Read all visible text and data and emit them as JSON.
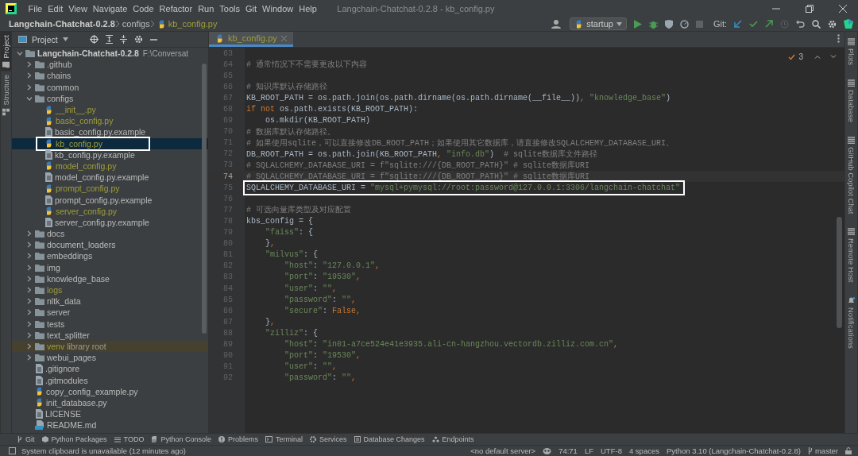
{
  "menu_bar": {
    "items": [
      "File",
      "Edit",
      "View",
      "Navigate",
      "Code",
      "Refactor",
      "Run",
      "Tools",
      "Git",
      "Window",
      "Help"
    ],
    "title": "Langchain-Chatchat-0.2.8 - kb_config.py"
  },
  "nav_bar": {
    "breadcrumbs": [
      "Langchain-Chatchat-0.2.8",
      "configs",
      "kb_config.py"
    ],
    "run_config": "startup",
    "git_label": "Git:"
  },
  "left_strip": [
    {
      "label": "Project",
      "selected": true
    },
    {
      "label": "Structure",
      "selected": false
    }
  ],
  "project_panel": {
    "title": "Project",
    "tree": [
      {
        "name": "Langchain-Chatchat-0.2.8",
        "path": "F:\\Conversat",
        "kind": "folder",
        "expanded": true,
        "ignored": false,
        "selected": false,
        "outlined": false,
        "children": [
          {
            "name": ".github",
            "kind": "folder",
            "expanded": false,
            "ignored": false,
            "selected": false,
            "outlined": false
          },
          {
            "name": "chains",
            "kind": "folder",
            "expanded": false,
            "ignored": false,
            "selected": false,
            "outlined": false
          },
          {
            "name": "common",
            "kind": "folder",
            "expanded": false,
            "ignored": false,
            "selected": false,
            "outlined": false
          },
          {
            "name": "configs",
            "kind": "folder",
            "expanded": true,
            "ignored": false,
            "selected": false,
            "outlined": false,
            "children": [
              {
                "name": "__init__.py",
                "kind": "python",
                "ignored": true,
                "selected": false,
                "outlined": false
              },
              {
                "name": "basic_config.py",
                "kind": "python",
                "ignored": true,
                "selected": false,
                "outlined": false
              },
              {
                "name": "basic_config.py.example",
                "kind": "file",
                "ignored": false,
                "selected": false,
                "outlined": false
              },
              {
                "name": "kb_config.py",
                "kind": "python",
                "ignored": true,
                "selected": true,
                "outlined": true
              },
              {
                "name": "kb_config.py.example",
                "kind": "file",
                "ignored": false,
                "selected": false,
                "outlined": false
              },
              {
                "name": "model_config.py",
                "kind": "python",
                "ignored": true,
                "selected": false,
                "outlined": false
              },
              {
                "name": "model_config.py.example",
                "kind": "file",
                "ignored": false,
                "selected": false,
                "outlined": false
              },
              {
                "name": "prompt_config.py",
                "kind": "python",
                "ignored": true,
                "selected": false,
                "outlined": false
              },
              {
                "name": "prompt_config.py.example",
                "kind": "file",
                "ignored": false,
                "selected": false,
                "outlined": false
              },
              {
                "name": "server_config.py",
                "kind": "python",
                "ignored": true,
                "selected": false,
                "outlined": false
              },
              {
                "name": "server_config.py.example",
                "kind": "file",
                "ignored": false,
                "selected": false,
                "outlined": false
              }
            ]
          },
          {
            "name": "docs",
            "kind": "folder",
            "expanded": false,
            "ignored": false,
            "selected": false,
            "outlined": false
          },
          {
            "name": "document_loaders",
            "kind": "folder",
            "expanded": false,
            "ignored": false,
            "selected": false,
            "outlined": false
          },
          {
            "name": "embeddings",
            "kind": "folder",
            "expanded": false,
            "ignored": false,
            "selected": false,
            "outlined": false
          },
          {
            "name": "img",
            "kind": "folder",
            "expanded": false,
            "ignored": false,
            "selected": false,
            "outlined": false
          },
          {
            "name": "knowledge_base",
            "kind": "folder",
            "expanded": false,
            "ignored": false,
            "selected": false,
            "outlined": false
          },
          {
            "name": "logs",
            "kind": "folder",
            "expanded": false,
            "ignored": true,
            "selected": false,
            "outlined": false
          },
          {
            "name": "nltk_data",
            "kind": "folder",
            "expanded": false,
            "ignored": false,
            "selected": false,
            "outlined": false
          },
          {
            "name": "server",
            "kind": "folder",
            "expanded": false,
            "ignored": false,
            "selected": false,
            "outlined": false
          },
          {
            "name": "tests",
            "kind": "folder",
            "expanded": false,
            "ignored": false,
            "selected": false,
            "outlined": false
          },
          {
            "name": "text_splitter",
            "kind": "folder",
            "expanded": false,
            "ignored": false,
            "selected": false,
            "outlined": false
          },
          {
            "name": "venv",
            "note": "library root",
            "kind": "folder",
            "expanded": false,
            "ignored": true,
            "selected": false,
            "outlined": false
          },
          {
            "name": "webui_pages",
            "kind": "folder",
            "expanded": false,
            "ignored": false,
            "selected": false,
            "outlined": false
          },
          {
            "name": ".gitignore",
            "kind": "file",
            "ignored": false,
            "selected": false,
            "outlined": false
          },
          {
            "name": ".gitmodules",
            "kind": "file",
            "ignored": false,
            "selected": false,
            "outlined": false
          },
          {
            "name": "copy_config_example.py",
            "kind": "python",
            "ignored": false,
            "selected": false,
            "outlined": false
          },
          {
            "name": "init_database.py",
            "kind": "python",
            "ignored": false,
            "selected": false,
            "outlined": false
          },
          {
            "name": "LICENSE",
            "kind": "file",
            "ignored": false,
            "selected": false,
            "outlined": false
          },
          {
            "name": "README.md",
            "kind": "markdown",
            "ignored": false,
            "selected": false,
            "outlined": false
          }
        ]
      }
    ]
  },
  "editor": {
    "tabs": [
      {
        "label": "kb_config.py",
        "selected": true
      }
    ],
    "inspection_count": "3",
    "lines": [
      {
        "number": "63",
        "current": false,
        "outlined": false
      },
      {
        "number": "64",
        "current": false,
        "outlined": false,
        "tokens": [
          {
            "kind": "comment",
            "text": "# 通常情况下不需要更改以下内容"
          }
        ]
      },
      {
        "number": "65",
        "current": false,
        "outlined": false
      },
      {
        "number": "66",
        "current": false,
        "outlined": false,
        "tokens": [
          {
            "kind": "comment",
            "text": "# 知识库默认存储路径"
          }
        ]
      },
      {
        "number": "67",
        "current": false,
        "outlined": false,
        "tokens": [
          {
            "kind": "plain",
            "text": "KB_ROOT_PATH = os.path.join(os.path.dirname(os.path.dirname(__file__))"
          },
          {
            "kind": "punct",
            "text": ", "
          },
          {
            "kind": "string",
            "text": "\"knowledge_base\""
          },
          {
            "kind": "plain",
            "text": ")"
          }
        ]
      },
      {
        "number": "68",
        "current": false,
        "outlined": false,
        "tokens": [
          {
            "kind": "keyword",
            "text": "if not"
          },
          {
            "kind": "plain",
            "text": " os.path.exists(KB_ROOT_PATH):"
          }
        ]
      },
      {
        "number": "69",
        "current": false,
        "outlined": false,
        "tokens": [
          {
            "kind": "plain",
            "text": "    os.mkdir(KB_ROOT_PATH)"
          }
        ]
      },
      {
        "number": "70",
        "current": false,
        "outlined": false,
        "tokens": [
          {
            "kind": "comment",
            "text": "# 数据库默认存储路径。"
          }
        ]
      },
      {
        "number": "71",
        "current": false,
        "outlined": false,
        "tokens": [
          {
            "kind": "comment",
            "text": "# 如果使用sqlite，可以直接修改DB_ROOT_PATH；如果使用其它数据库，请直接修改SQLALCHEMY_DATABASE_URI。"
          }
        ]
      },
      {
        "number": "72",
        "current": false,
        "outlined": false,
        "tokens": [
          {
            "kind": "plain",
            "text": "DB_ROOT_PATH = os.path.join(KB_ROOT_PATH"
          },
          {
            "kind": "punct",
            "text": ", "
          },
          {
            "kind": "string",
            "text": "\"info.db\""
          },
          {
            "kind": "plain",
            "text": ")"
          },
          {
            "kind": "comment",
            "text": "  # sqlite数据库文件路径"
          }
        ]
      },
      {
        "number": "73",
        "current": false,
        "outlined": false,
        "tokens": [
          {
            "kind": "comment",
            "text": "# SQLALCHEMY_DATABASE_URI = f\"sqlite:///{DB_ROOT_PATH}\" # sqlite数据库URI"
          }
        ]
      },
      {
        "number": "74",
        "current": true,
        "outlined": false,
        "tokens": [
          {
            "kind": "comment",
            "text": "# SQLALCHEMY_DATABASE_URI = f\"sqlite:///{DB_ROOT_PATH}\" # sqlite数据库URI"
          }
        ]
      },
      {
        "number": "75",
        "current": false,
        "outlined": true,
        "tokens": [
          {
            "kind": "plain",
            "text": "SQLALCHEMY_DATABASE_URI = "
          },
          {
            "kind": "string",
            "text": "\"mysql+pymysql://root:password@127.0.0.1:3306/langchain-chatchat\""
          }
        ]
      },
      {
        "number": "76",
        "current": false,
        "outlined": false
      },
      {
        "number": "77",
        "current": false,
        "outlined": false,
        "tokens": [
          {
            "kind": "comment",
            "text": "# 可选向量库类型及对应配置"
          }
        ]
      },
      {
        "number": "78",
        "current": false,
        "outlined": false,
        "tokens": [
          {
            "kind": "plain",
            "text": "kbs_config = {"
          }
        ]
      },
      {
        "number": "79",
        "current": false,
        "outlined": false,
        "tokens": [
          {
            "kind": "string",
            "text": "    \"faiss\""
          },
          {
            "kind": "plain",
            "text": ": {"
          }
        ]
      },
      {
        "number": "80",
        "current": false,
        "outlined": false,
        "tokens": [
          {
            "kind": "plain",
            "text": "    }"
          },
          {
            "kind": "punct",
            "text": ","
          }
        ]
      },
      {
        "number": "81",
        "current": false,
        "outlined": false,
        "tokens": [
          {
            "kind": "string",
            "text": "    \"milvus\""
          },
          {
            "kind": "plain",
            "text": ": {"
          }
        ]
      },
      {
        "number": "82",
        "current": false,
        "outlined": false,
        "tokens": [
          {
            "kind": "string",
            "text": "        \"host\""
          },
          {
            "kind": "plain",
            "text": ": "
          },
          {
            "kind": "string",
            "text": "\"127.0.0.1\""
          },
          {
            "kind": "punct",
            "text": ","
          }
        ]
      },
      {
        "number": "83",
        "current": false,
        "outlined": false,
        "tokens": [
          {
            "kind": "string",
            "text": "        \"port\""
          },
          {
            "kind": "plain",
            "text": ": "
          },
          {
            "kind": "string",
            "text": "\"19530\""
          },
          {
            "kind": "punct",
            "text": ","
          }
        ]
      },
      {
        "number": "84",
        "current": false,
        "outlined": false,
        "tokens": [
          {
            "kind": "string",
            "text": "        \"user\""
          },
          {
            "kind": "plain",
            "text": ": "
          },
          {
            "kind": "string",
            "text": "\"\""
          },
          {
            "kind": "punct",
            "text": ","
          }
        ]
      },
      {
        "number": "85",
        "current": false,
        "outlined": false,
        "tokens": [
          {
            "kind": "string",
            "text": "        \"password\""
          },
          {
            "kind": "plain",
            "text": ": "
          },
          {
            "kind": "string",
            "text": "\"\""
          },
          {
            "kind": "punct",
            "text": ","
          }
        ]
      },
      {
        "number": "86",
        "current": false,
        "outlined": false,
        "tokens": [
          {
            "kind": "string",
            "text": "        \"secure\""
          },
          {
            "kind": "plain",
            "text": ": "
          },
          {
            "kind": "keyword",
            "text": "False"
          },
          {
            "kind": "punct",
            "text": ","
          }
        ]
      },
      {
        "number": "87",
        "current": false,
        "outlined": false,
        "tokens": [
          {
            "kind": "plain",
            "text": "    }"
          },
          {
            "kind": "punct",
            "text": ","
          }
        ]
      },
      {
        "number": "88",
        "current": false,
        "outlined": false,
        "tokens": [
          {
            "kind": "string",
            "text": "    \"zilliz\""
          },
          {
            "kind": "plain",
            "text": ": {"
          }
        ]
      },
      {
        "number": "89",
        "current": false,
        "outlined": false,
        "tokens": [
          {
            "kind": "string",
            "text": "        \"host\""
          },
          {
            "kind": "plain",
            "text": ": "
          },
          {
            "kind": "string",
            "text": "\"in01-a7ce524e41e3935.ali-cn-hangzhou.vectordb.zilliz.com.cn\""
          },
          {
            "kind": "punct",
            "text": ","
          }
        ]
      },
      {
        "number": "90",
        "current": false,
        "outlined": false,
        "tokens": [
          {
            "kind": "string",
            "text": "        \"port\""
          },
          {
            "kind": "plain",
            "text": ": "
          },
          {
            "kind": "string",
            "text": "\"19530\""
          },
          {
            "kind": "punct",
            "text": ","
          }
        ]
      },
      {
        "number": "91",
        "current": false,
        "outlined": false,
        "tokens": [
          {
            "kind": "string",
            "text": "        \"user\""
          },
          {
            "kind": "plain",
            "text": ": "
          },
          {
            "kind": "string",
            "text": "\"\""
          },
          {
            "kind": "punct",
            "text": ","
          }
        ]
      },
      {
        "number": "92",
        "current": false,
        "outlined": false,
        "tokens": [
          {
            "kind": "string",
            "text": "        \"password\""
          },
          {
            "kind": "plain",
            "text": ": "
          },
          {
            "kind": "string",
            "text": "\"\""
          },
          {
            "kind": "punct",
            "text": ","
          }
        ]
      }
    ]
  },
  "right_strip": [
    "Plots",
    "Database",
    "GitHub Copilot Chat",
    "Remote Host",
    "Notifications"
  ],
  "tool_windows": [
    "Git",
    "Python Packages",
    "TODO",
    "Python Console",
    "Problems",
    "Terminal",
    "Services",
    "Database Changes",
    "Endpoints"
  ],
  "status_bar": {
    "message": "System clipboard is unavailable (12 minutes ago)",
    "server": "<no default server>",
    "items": [
      "74:71",
      "LF",
      "UTF-8",
      "4 spaces",
      "Python 3.10 (Langchain-Chatchat-0.2.8)"
    ],
    "branch": "master"
  }
}
